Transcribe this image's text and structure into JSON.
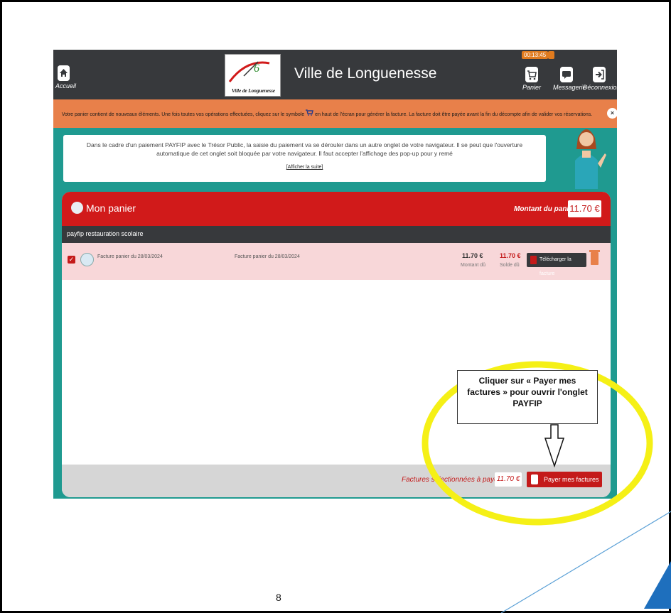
{
  "app": {
    "title": "Ville de Longuenesse",
    "logo_text": "Ville de Longuenesse",
    "timer": "00:13:45"
  },
  "nav": {
    "home": "Accueil",
    "cart": "Panier",
    "messages": "Messagerie",
    "logout": "Déconnexion"
  },
  "banner": {
    "text_before": "Votre panier contient de nouveaux éléments. Une fois toutes vos opérations effectuées, cliquez sur le symbole",
    "text_after": "en haut de l'écran pour générer la facture. La facture doit être payée avant la fin du décompte afin de valider vos réservations.",
    "close": "×"
  },
  "info": {
    "text": "Dans le cadre d'un paiement PAYFIP avec le Trésor Public, la saisie du paiement va se dérouler dans un autre onglet de votre navigateur. Il se peut que l'ouverture automatique de cet onglet soit bloquée par votre navigateur. Il faut accepter l'affichage des pop-up pour y remé",
    "more_link": "[Afficher la suite]"
  },
  "cart": {
    "title": "Mon panier",
    "total_label": "Montant du panier :",
    "total_value": "11.70 €",
    "category": "payfip restauration scolaire",
    "row": {
      "label": "Facture panier du 28/03/2024",
      "label2": "Facture panier du 28/03/2024",
      "amount_due": "11.70 €",
      "amount_due_label": "Montant dû",
      "balance_due": "11.70 €",
      "balance_due_label": "Solde dû",
      "download_label": "Télécharger la facture"
    },
    "selected_label": "Factures sélectionnées à payer",
    "selected_value": "11.70 €",
    "pay_label": "Payer mes factures"
  },
  "annotation": {
    "callout_line1": "Cliquer sur « Payer mes",
    "callout_line2": "factures » pour ouvrir l'onglet",
    "callout_line3": "PAYFIP",
    "ring_color": "#f5f016"
  },
  "page_number": "8",
  "colors": {
    "topbar": "#37393c",
    "accent_red": "#d11a1a",
    "banner_orange": "#e8804a",
    "teal_background": "#1f9a90"
  }
}
